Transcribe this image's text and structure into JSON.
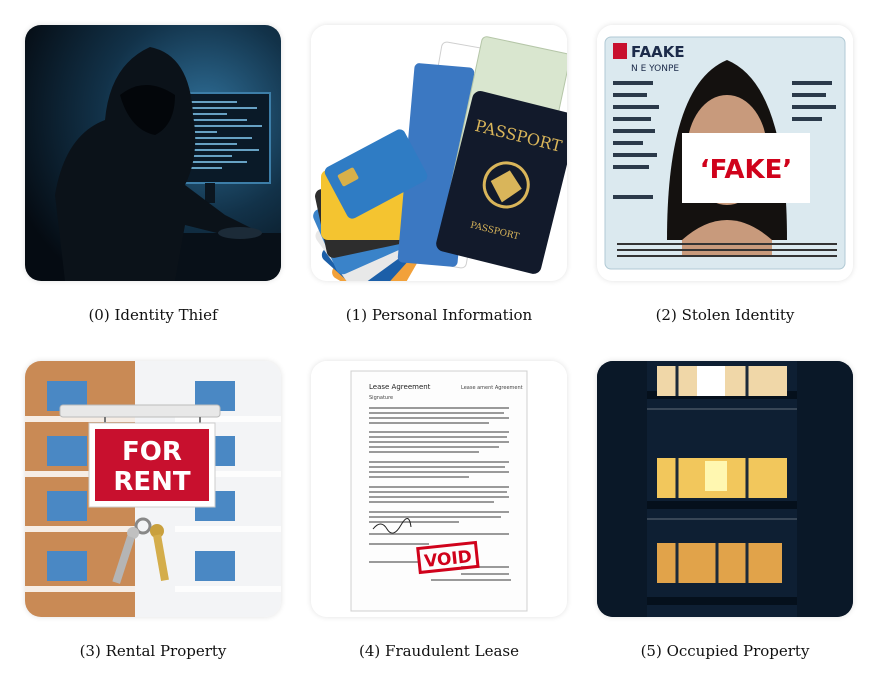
{
  "captions": [
    "(0) Identity Thief",
    "(1) Personal Information",
    "(2) Stolen Identity",
    "(3) Rental Property",
    "(4) Fraudulent Lease",
    "(5) Occupied Property"
  ],
  "id_card": {
    "header": "FAAKE",
    "sub_header": "N E YONPE",
    "stamp": "‘FAKE’"
  },
  "passport": {
    "title": "PASSPORT",
    "footer": "PASSPORT"
  },
  "rent_sign": {
    "line1": "FOR",
    "line2": "RENT"
  },
  "lease": {
    "title": "Lease  Agreement",
    "title_right": "Lease ament Agreement",
    "signature": "Signature",
    "stamp": "VOID"
  },
  "colors": {
    "rent_red": "#c8102e",
    "void_red": "#d0021b",
    "night_blue": "#0e1f33",
    "window_yellow": "#f2c75c"
  }
}
